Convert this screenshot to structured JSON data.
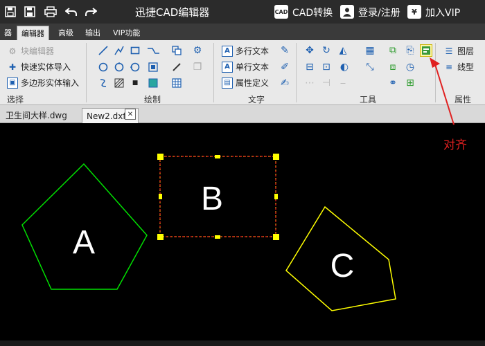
{
  "titlebar": {
    "title": "迅捷CAD编辑器",
    "cad_convert_icon": "CAD",
    "cad_convert": "CAD转换",
    "login": "登录/注册",
    "vip_icon": "¥",
    "vip": "加入VIP"
  },
  "tabs": [
    "器",
    "编辑器",
    "高级",
    "输出",
    "VIP功能"
  ],
  "ribbon": {
    "select_group": {
      "label": "选择",
      "items": [
        "块编辑器",
        "快速实体导入",
        "多边形实体输入"
      ]
    },
    "draw_group": {
      "label": "绘制"
    },
    "text_group": {
      "label": "文字",
      "items": [
        "多行文本",
        "单行文本",
        "属性定义"
      ],
      "icon_letter": "A"
    },
    "tools_group": {
      "label": "工具"
    },
    "props_group": {
      "label": "属性",
      "items": [
        "图层",
        "线型"
      ]
    }
  },
  "doc_tabs": [
    "卫生间大样.dwg",
    "New2.dxf"
  ],
  "doc_close": "✕",
  "canvas": {
    "shape_labels": [
      "A",
      "B",
      "C"
    ],
    "colors": {
      "A": "#00e000",
      "B_selection": "#ff2020",
      "grip": "#ffff00",
      "C": "#ffff00"
    }
  },
  "annotation": {
    "text": "对齐",
    "color": "#e02020"
  }
}
